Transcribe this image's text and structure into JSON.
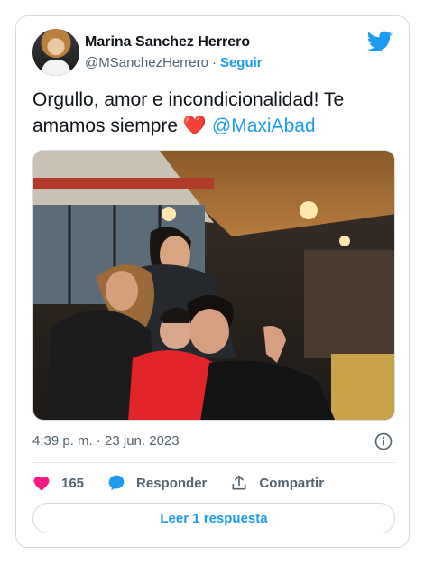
{
  "author": {
    "name": "Marina Sanchez Herrero",
    "handle": "@MSanchezHerrero",
    "separator": "·",
    "follow_label": "Seguir"
  },
  "tweet": {
    "text": "Orgullo, amor e incondicionalidad! Te amamos siempre",
    "emoji": "❤️",
    "mention": "@MaxiAbad"
  },
  "meta": {
    "timestamp": "4:39 p. m. · 23 jun. 2023"
  },
  "actions": {
    "likes": "165",
    "reply_label": "Responder",
    "share_label": "Compartir"
  },
  "footer": {
    "read_replies_label": "Leer 1 respuesta"
  },
  "colors": {
    "accent": "#1d9bf0",
    "heart": "#f91880"
  },
  "icons": [
    "twitter-icon",
    "heart-icon",
    "reply-icon",
    "share-icon",
    "info-icon"
  ]
}
